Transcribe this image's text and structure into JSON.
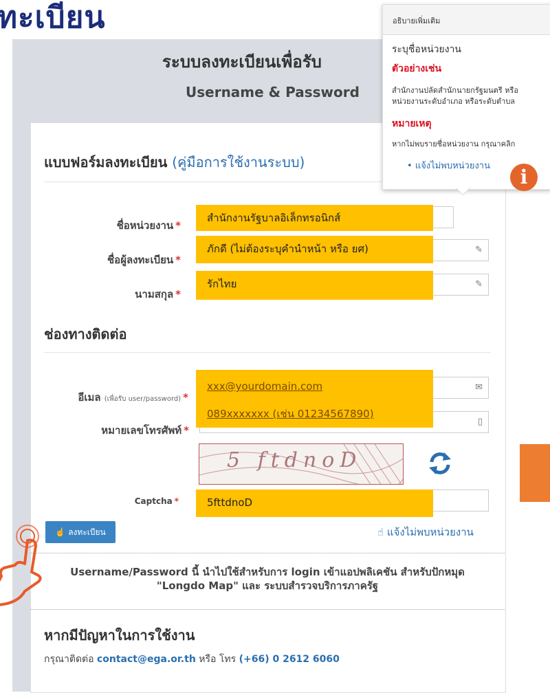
{
  "page": {
    "big_title": "ทะเบียน",
    "header_title": "ระบบลงทะเบียนเพื่อรับ",
    "header_subtitle": "Username & Password"
  },
  "form": {
    "heading": "แบบฟอร์มลงทะเบียน",
    "manual_link": "(คู่มือการใช้งานระบบ)",
    "fields": {
      "agency_label": "ชื่อหน่วยงาน",
      "agency_value": "สำนักงานรัฐบาลอิเล็กทรอนิกส์",
      "firstname_label": "ชื่อผู้ลงทะเบียน",
      "firstname_value": "ภักดี (ไม่ต้องระบุคำนำหน้า หรือ ยศ)",
      "lastname_label": "นามสกุล",
      "lastname_value": "รักไทย"
    },
    "contact_section": "ช่องทางติดต่อ",
    "email_label": "อีเมล",
    "email_note": "(เพื่อรับ user/password)",
    "email_value": "xxx@yourdomain.com",
    "phone_label": "หมายเลขโทรศัพท์",
    "phone_value": "089xxxxxxx (เช่น 01234567890)",
    "captcha_image_text": "5 ftdnoD",
    "captcha_label": "Captcha",
    "captcha_value": "5fttdnoD",
    "required_mark": "*",
    "register_button": "ลงทะเบียน",
    "report_link": "แจ้งไม่พบหน่วยงาน"
  },
  "note": {
    "line1": "Username/Password นี้ นำไปใช้สำหรับการ login เข้าแอปพลิเคชัน สำหรับปักหมุด",
    "line2": "\"Longdo Map\" และ ระบบสำรวจบริการภาครัฐ"
  },
  "help": {
    "title": "หากมีปัญหาในการใช้งาน",
    "contact_prefix": "กรุณาติดต่อ",
    "email": "contact@ega.or.th",
    "or_phone": "หรือ โทร",
    "phone": "(+66) 0 2612 6060"
  },
  "popover": {
    "header": "อธิบายเพิ่มเติม",
    "title": "ระบุชื่อหน่วยงาน",
    "example_heading": "ตัวอย่างเช่น",
    "example_line1": "สำนักงานปลัดสำนักนายกรัฐมนตรี หรือ",
    "example_line2": "หน่วยงานระดับอำเภอ หรือระดับตำบล",
    "note_heading": "หมายเหตุ",
    "note_text": "หากไม่พบรายชื่อหน่วยงาน กรุณาคลิก",
    "report_item": "แจ้งไม่พบหน่วยงาน",
    "info_glyph": "i"
  },
  "colors": {
    "highlight": "#ffc000",
    "accent_blue": "#2a6fb0",
    "orange": "#e4652b",
    "panel": "#d9dde3"
  },
  "icons": [
    "edit-icon",
    "envelope-icon",
    "phone-icon",
    "refresh-icon",
    "hand-pointer-icon",
    "info-icon"
  ]
}
